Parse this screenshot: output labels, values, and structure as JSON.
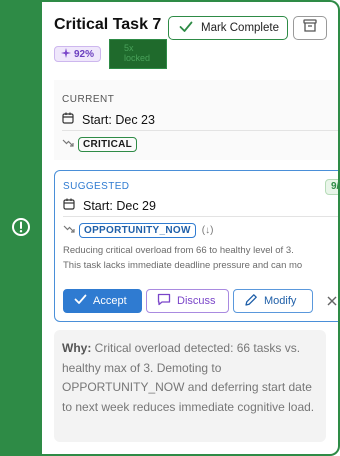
{
  "task": {
    "title": "Critical Task 7",
    "score": "92%",
    "lock_badge": "5x\nlocked"
  },
  "header": {
    "complete_label": "Mark Complete"
  },
  "current": {
    "label": "CURRENT",
    "start": "Start: Dec 23",
    "priority": "CRITICAL"
  },
  "suggested": {
    "label": "SUGGESTED",
    "badge": "9/",
    "start": "Start: Dec 29",
    "priority": "OPPORTUNITY_NOW",
    "priority_direction": "(↓)",
    "description_line1": "Reducing critical overload from 66 to healthy level of 3.",
    "description_line2": "This task lacks immediate deadline pressure and can mo",
    "accept_label": "Accept",
    "discuss_label": "Discuss",
    "modify_label": "Modify"
  },
  "why": {
    "label": "Why:",
    "text": "Critical overload detected: 66 tasks vs. healthy max of 3. Demoting to OPPORTUNITY_NOW and deferring start date to next week reduces immediate cognitive load."
  },
  "colors": {
    "accent_green": "#2e8b46",
    "accent_blue": "#2f7bd1",
    "accent_purple": "#7a45c9"
  }
}
